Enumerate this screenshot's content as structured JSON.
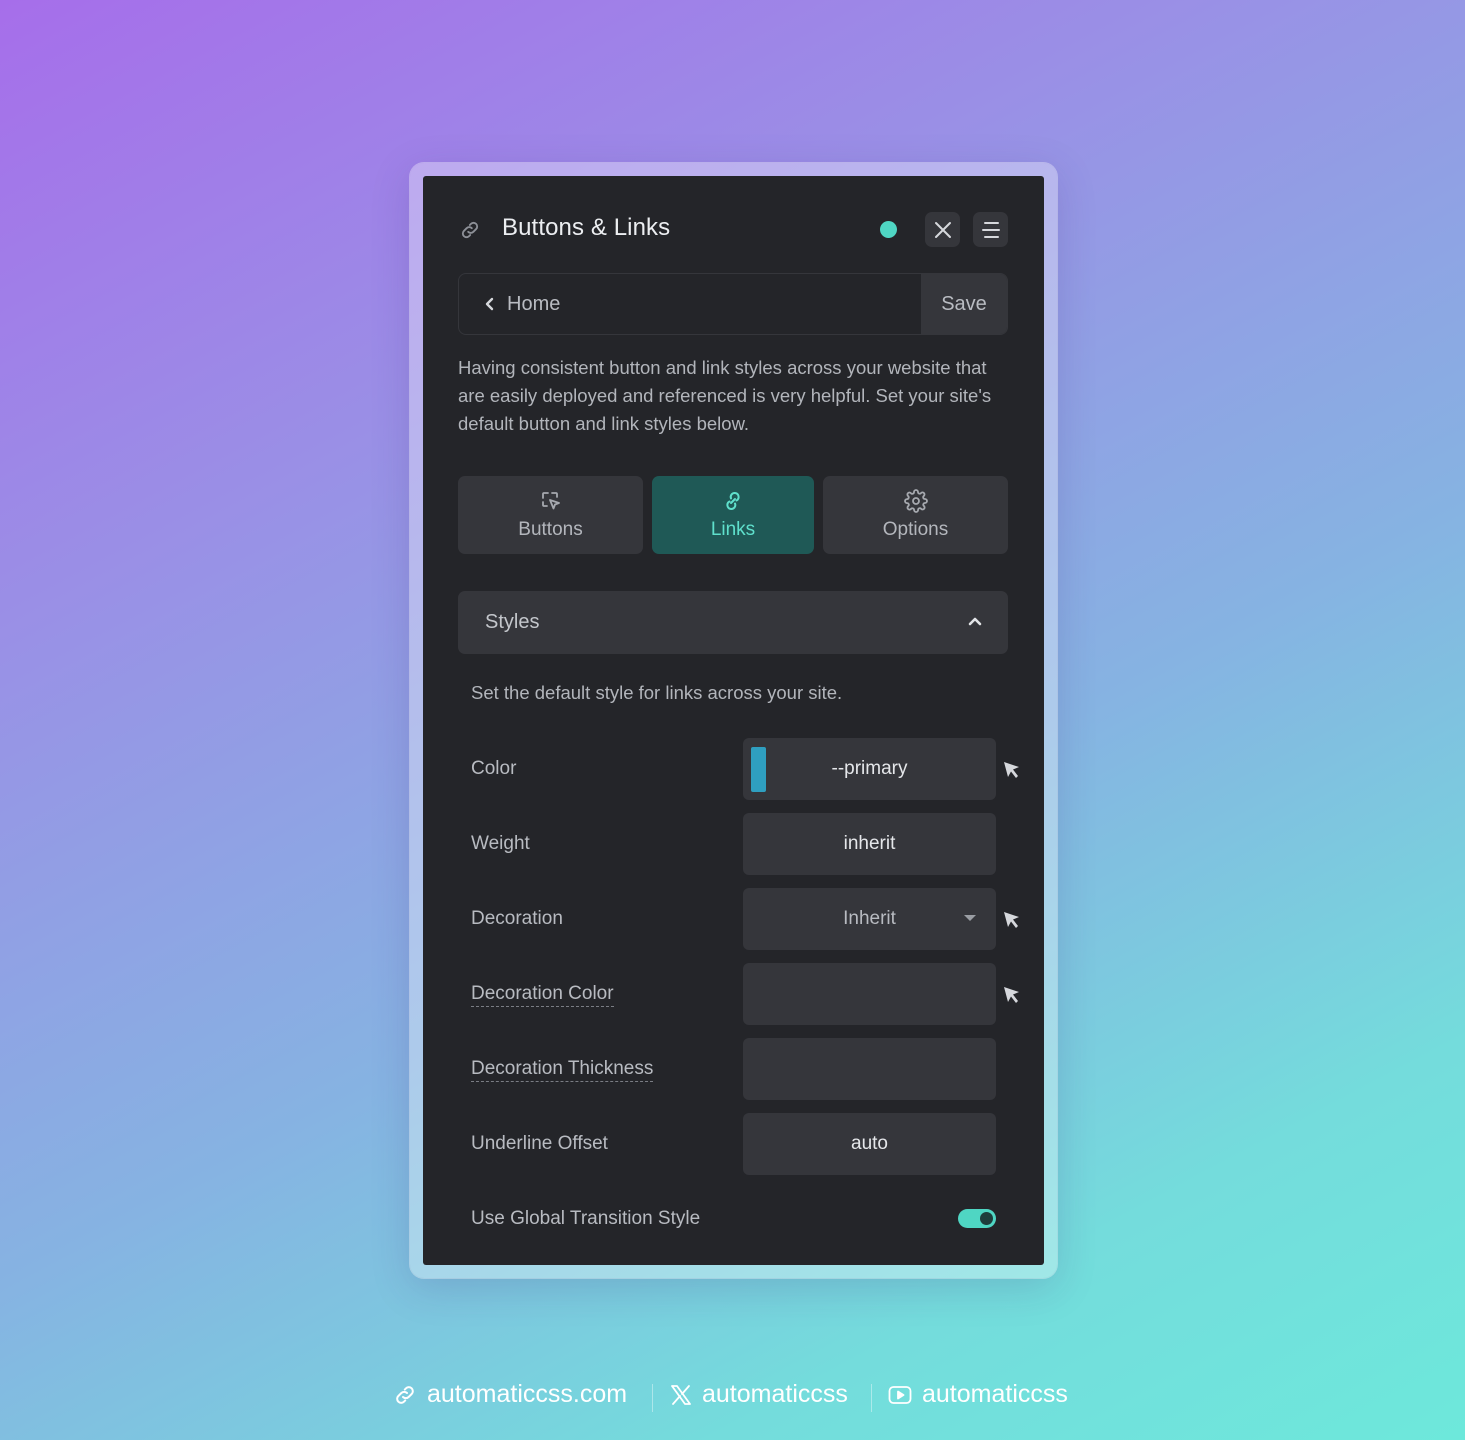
{
  "panel": {
    "title": "Buttons & Links",
    "status_color": "#4fd6c3",
    "accent_color": "#5fe0cc"
  },
  "nav": {
    "back_label": "Home",
    "save_label": "Save"
  },
  "intro": "Having consistent button and link styles across your website that are easily deployed and referenced is very helpful. Set your site's default button and link styles below.",
  "tabs": [
    {
      "label": "Buttons",
      "icon": "pointer-select-icon",
      "active": false
    },
    {
      "label": "Links",
      "icon": "link-icon",
      "active": true
    },
    {
      "label": "Options",
      "icon": "gear-icon",
      "active": false
    }
  ],
  "section": {
    "title": "Styles",
    "description": "Set the default style for links across your site."
  },
  "fields": {
    "color": {
      "label": "Color",
      "value": "--primary",
      "swatch": "#2f9fc0"
    },
    "weight": {
      "label": "Weight",
      "value": "inherit"
    },
    "decoration": {
      "label": "Decoration",
      "value": "Inherit"
    },
    "decoration_color": {
      "label": "Decoration Color",
      "value": ""
    },
    "decoration_thickness": {
      "label": "Decoration Thickness",
      "value": ""
    },
    "underline_offset": {
      "label": "Underline Offset",
      "value": "auto"
    },
    "global_transition": {
      "label": "Use Global Transition Style",
      "enabled": true
    }
  },
  "footer": {
    "website": "automaticcss.com",
    "x_handle": "automaticcss",
    "youtube": "automaticcss"
  }
}
